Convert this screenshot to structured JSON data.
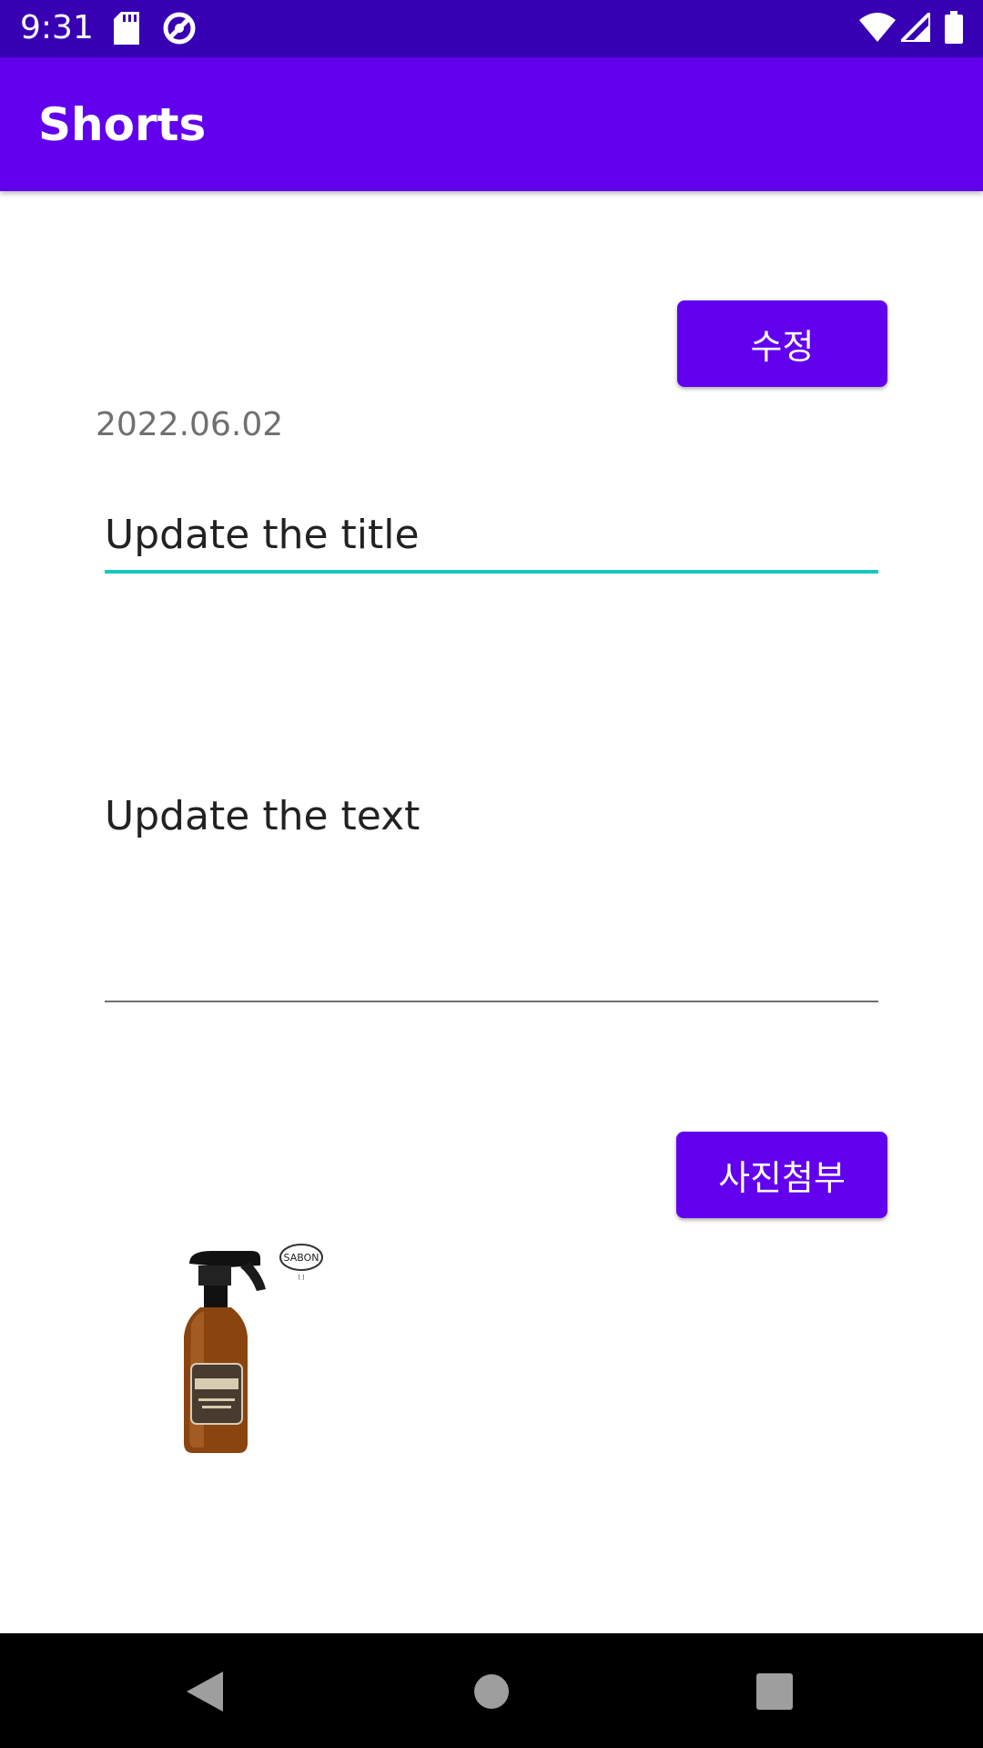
{
  "status_bar": {
    "time": "9:31",
    "left_icons": [
      "sd-card-icon",
      "sync-icon"
    ],
    "right_icons": [
      "wifi-icon",
      "cell-signal-icon",
      "battery-icon"
    ]
  },
  "app_bar": {
    "title": "Shorts"
  },
  "edit_button": {
    "label": "수정"
  },
  "date": "2022.06.02",
  "title_field": {
    "value": "Update the title",
    "focused": true,
    "underline_color": "#1bc6c0"
  },
  "text_field": {
    "value": "Update the text",
    "underline_color": "#707070"
  },
  "attach_button": {
    "label": "사진첨부"
  },
  "attached_image": {
    "icon": "spray-bottle-image",
    "brand_text": "SABON"
  },
  "nav_bar": {
    "icons": [
      "back-icon",
      "home-icon",
      "recents-icon"
    ]
  },
  "colors": {
    "primary": "#6200ee",
    "primary_dark": "#3700b3",
    "accent": "#1bc6c0"
  }
}
